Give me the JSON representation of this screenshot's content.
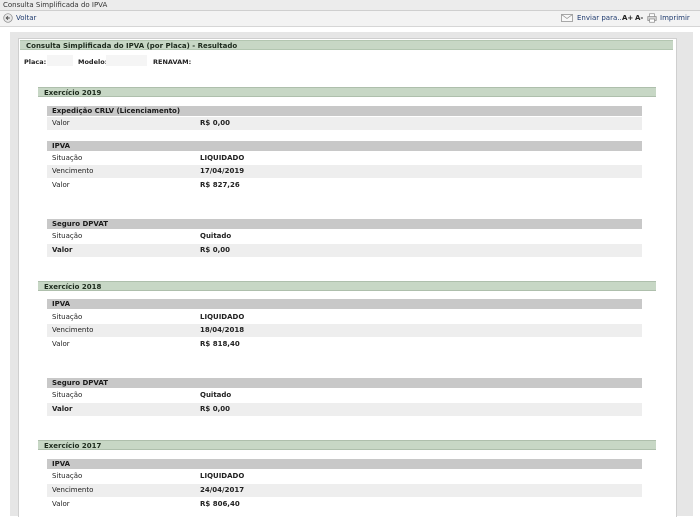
{
  "window": {
    "title": "Consulta Simplificada do IPVA"
  },
  "toolbar": {
    "back": "Voltar",
    "send": "Enviar para...",
    "font_up": "A+",
    "font_down": "A-",
    "print": "Imprimir"
  },
  "panel": {
    "title": "Consulta Simplificada do IPVA (por Placa) - Resultado",
    "placa": "Placa:",
    "modelo": "Modelo:",
    "renavam": "RENAVAM:"
  },
  "ex2019": {
    "header": "Exercício 2019",
    "crlv": {
      "title": "Expedição CRLV (Licenciamento)",
      "valor_label": "Valor",
      "valor": "R$ 0,00"
    },
    "ipva": {
      "title": "IPVA",
      "situacao_label": "Situação",
      "situacao": "LIQUIDADO",
      "vencimento_label": "Vencimento",
      "vencimento": "17/04/2019",
      "valor_label": "Valor",
      "valor": "R$ 827,26"
    },
    "dpvat": {
      "title": "Seguro DPVAT",
      "situacao_label": "Situação",
      "situacao": "Quitado",
      "valor_label": "Valor",
      "valor": "R$ 0,00"
    }
  },
  "ex2018": {
    "header": "Exercício 2018",
    "ipva": {
      "title": "IPVA",
      "situacao_label": "Situação",
      "situacao": "LIQUIDADO",
      "vencimento_label": "Vencimento",
      "vencimento": "18/04/2018",
      "valor_label": "Valor",
      "valor": "R$ 818,40"
    },
    "dpvat": {
      "title": "Seguro DPVAT",
      "situacao_label": "Situação",
      "situacao": "Quitado",
      "valor_label": "Valor",
      "valor": "R$ 0,00"
    }
  },
  "ex2017": {
    "header": "Exercício 2017",
    "ipva": {
      "title": "IPVA",
      "situacao_label": "Situação",
      "situacao": "LIQUIDADO",
      "vencimento_label": "Vencimento",
      "vencimento": "24/04/2017",
      "valor_label": "Valor",
      "valor": "R$ 806,40"
    }
  },
  "icons": {
    "back": "back-arrow-icon",
    "mail": "mail-icon",
    "print": "printer-icon"
  },
  "colors": {
    "section_green": "#c7d7c5",
    "subsection_gray": "#c8c8c8",
    "link_blue": "#1e3a6e"
  }
}
